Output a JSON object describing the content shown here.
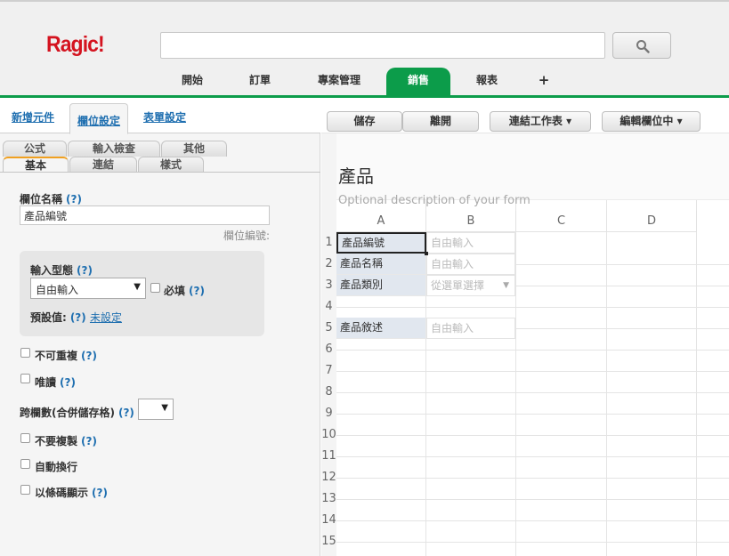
{
  "app": {
    "logo": "Ragic!"
  },
  "search": {
    "value": "",
    "placeholder": ""
  },
  "nav": {
    "tabs": [
      "開始",
      "訂單",
      "專案管理",
      "銷售",
      "報表",
      "+"
    ],
    "active": "銷售"
  },
  "left_panel": {
    "top_tabs": [
      "新增元件",
      "欄位設定",
      "表單設定"
    ],
    "sub_tabs_row1": [
      "公式",
      "輸入檢查",
      "其他"
    ],
    "sub_tabs_row2": [
      "基本",
      "連結",
      "樣式"
    ],
    "field_name_label": "欄位名稱",
    "help": "(?)",
    "field_name_value": "產品編號",
    "field_number_label": "欄位編號:",
    "input_type_label": "輸入型態",
    "input_type_value": "自由輸入",
    "required_label": "必填",
    "default_label": "預設值:",
    "default_value": "未設定",
    "options": {
      "unique": "不可重複",
      "readonly": "唯讀",
      "span_label": "跨欄數(合併儲存格)",
      "no_copy": "不要複製",
      "wrap": "自動換行",
      "barcode": "以條碼顯示"
    }
  },
  "toolbar": {
    "save": "儲存",
    "leave": "離開",
    "link_sheet": "連結工作表 ▾",
    "editing": "編輯欄位中 ▾"
  },
  "form": {
    "title": "產品",
    "description_placeholder": "Optional description of your form",
    "columns": [
      "A",
      "B",
      "C",
      "D"
    ],
    "rows": [
      "1",
      "2",
      "3",
      "4",
      "5",
      "6",
      "7",
      "8",
      "9",
      "10",
      "11",
      "12",
      "13",
      "14",
      "15"
    ],
    "fields": [
      {
        "row": 1,
        "label": "產品編號",
        "input": "自由輸入"
      },
      {
        "row": 2,
        "label": "產品名稱",
        "input": "自由輸入"
      },
      {
        "row": 3,
        "label": "產品類別",
        "input": "從選單選擇"
      },
      {
        "row": 5,
        "label": "產品敘述",
        "input": "自由輸入"
      }
    ]
  },
  "colors": {
    "brand_green": "#0c9c4a",
    "logo_red": "#d4131f",
    "link_blue": "#1f6fb0"
  }
}
